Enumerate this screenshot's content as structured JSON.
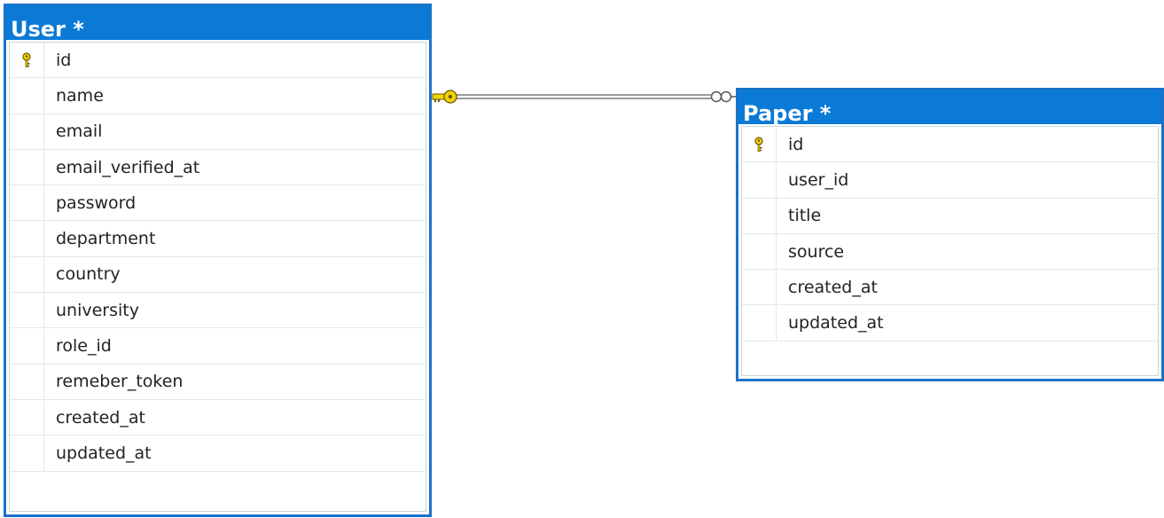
{
  "colors": {
    "header": "#0a7ad6",
    "border": "#1a73c9",
    "key": "#f2d400",
    "connector": "#9a9a9a"
  },
  "tables": [
    {
      "title": "User *",
      "columns": [
        {
          "name": "id",
          "primary_key": true
        },
        {
          "name": "name",
          "primary_key": false
        },
        {
          "name": "email",
          "primary_key": false
        },
        {
          "name": "email_verified_at",
          "primary_key": false
        },
        {
          "name": "password",
          "primary_key": false
        },
        {
          "name": "department",
          "primary_key": false
        },
        {
          "name": "country",
          "primary_key": false
        },
        {
          "name": "university",
          "primary_key": false
        },
        {
          "name": "role_id",
          "primary_key": false
        },
        {
          "name": "remeber_token",
          "primary_key": false
        },
        {
          "name": "created_at",
          "primary_key": false
        },
        {
          "name": "updated_at",
          "primary_key": false
        }
      ]
    },
    {
      "title": "Paper *",
      "columns": [
        {
          "name": "id",
          "primary_key": true
        },
        {
          "name": "user_id",
          "primary_key": false
        },
        {
          "name": "title",
          "primary_key": false
        },
        {
          "name": "source",
          "primary_key": false
        },
        {
          "name": "created_at",
          "primary_key": false
        },
        {
          "name": "updated_at",
          "primary_key": false
        }
      ]
    }
  ],
  "relationship": {
    "from_table": "User *",
    "to_table": "Paper *",
    "from_end": "key-icon",
    "to_end": "infinity-icon"
  }
}
